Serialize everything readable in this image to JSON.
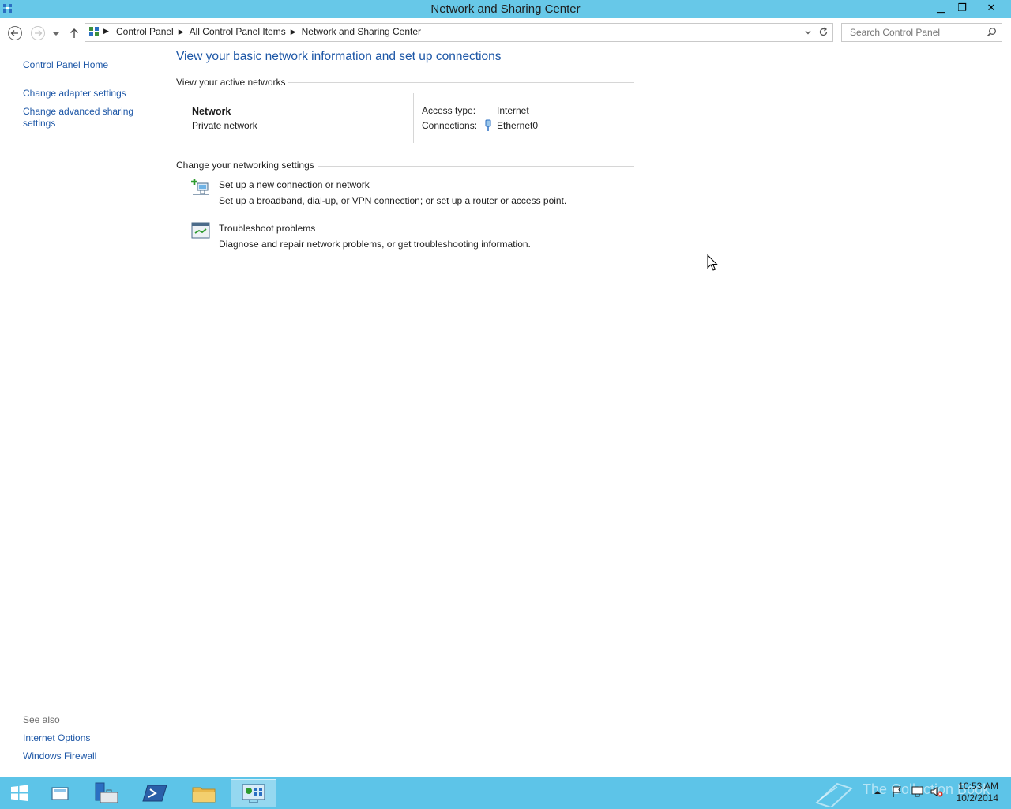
{
  "window": {
    "title": "Network and Sharing Center",
    "minimize_glyph": "▁",
    "restore_glyph": "❐",
    "close_glyph": "✕"
  },
  "address_bar": {
    "crumbs": [
      "Control Panel",
      "All Control Panel Items",
      "Network and Sharing Center"
    ],
    "search_placeholder": "Search Control Panel"
  },
  "left_pane": {
    "home": "Control Panel Home",
    "links": [
      "Change adapter settings",
      "Change advanced sharing settings"
    ],
    "see_also_label": "See also",
    "see_also": [
      "Internet Options",
      "Windows Firewall"
    ]
  },
  "main": {
    "heading": "View your basic network information and set up connections",
    "active_networks_label": "View your active networks",
    "network": {
      "name": "Network",
      "type": "Private network",
      "access_type_label": "Access type:",
      "access_type_value": "Internet",
      "connections_label": "Connections:",
      "connection_name": "Ethernet0"
    },
    "change_settings_label": "Change your networking settings",
    "tasks": [
      {
        "title": "Set up a new connection or network",
        "description": "Set up a broadband, dial-up, or VPN connection; or set up a router or access point.",
        "icon": "new-connection-icon"
      },
      {
        "title": "Troubleshoot problems",
        "description": "Diagnose and repair network problems, or get troubleshooting information.",
        "icon": "troubleshoot-icon"
      }
    ]
  },
  "taskbar": {
    "time": "10:53 AM",
    "date": "10/2/2014",
    "watermark": "The Collection Book",
    "color": "#5dc4e8"
  },
  "colors": {
    "title_bar": "#67c8e8",
    "link": "#1c56a6"
  }
}
